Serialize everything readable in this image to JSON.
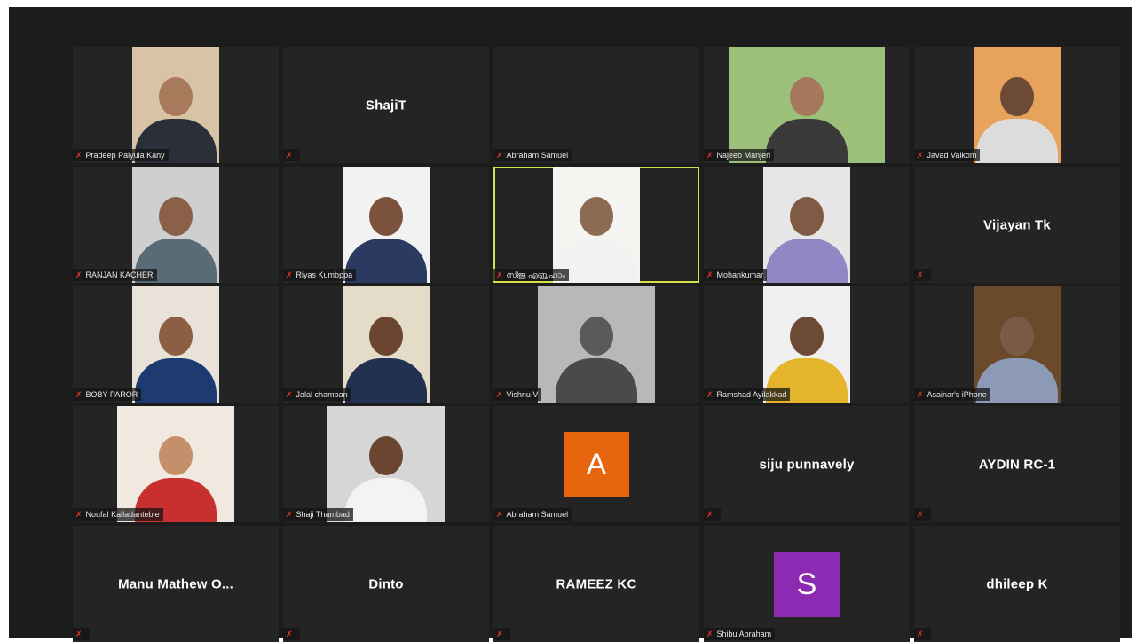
{
  "colors": {
    "background": "#1c1c1c",
    "tile": "#242424",
    "active_border": "#d6e04a",
    "muted_mic": "#e0342f"
  },
  "tiles": [
    {
      "id": "t0",
      "name": "Pradeep Paiyula Kany",
      "video": true,
      "bg": "#d9c3a6",
      "skin": "#a87a5c",
      "shirt": "#2b2f3a"
    },
    {
      "id": "t1",
      "name": "ShajiT",
      "video": false
    },
    {
      "id": "t2",
      "name": "Abraham Samuel",
      "video": false,
      "show_big": false
    },
    {
      "id": "t3",
      "name": "Najeeb Manjeri",
      "video": true,
      "bg": "#9cc07a",
      "skin": "#a5785d",
      "shirt": "#3a3a3a"
    },
    {
      "id": "t4",
      "name": "Javad Valkom",
      "video": true,
      "bg": "#e7a35c",
      "skin": "#6d4a35",
      "shirt": "#dcdcdc"
    },
    {
      "id": "t5",
      "name": "RANJAN KACHER",
      "video": true,
      "bg": "#cfcfcf",
      "skin": "#8a6048",
      "shirt": "#5a6b78"
    },
    {
      "id": "t6",
      "name": "Riyas Kumbppa",
      "video": true,
      "bg": "#f2f2f2",
      "skin": "#7b523c",
      "shirt": "#2a3a60"
    },
    {
      "id": "t7",
      "name": "സിജു എബ്രഹാം",
      "video": true,
      "bg": "#f4f4f0",
      "skin": "#8d6b52",
      "shirt": "#f2f2f2",
      "active": true
    },
    {
      "id": "t8",
      "name": "Mohankumar",
      "video": true,
      "bg": "#e6e6e6",
      "skin": "#7f5a44",
      "shirt": "#9088c4"
    },
    {
      "id": "t9",
      "name": "Vijayan Tk",
      "video": false
    },
    {
      "id": "t10",
      "name": "BOBY PAROR",
      "video": true,
      "bg": "#e8e2d8",
      "skin": "#8c5f45",
      "shirt": "#1d3b70"
    },
    {
      "id": "t11",
      "name": "Jalal chamban",
      "video": true,
      "bg": "#e4dcc8",
      "skin": "#6b4530",
      "shirt": "#223150"
    },
    {
      "id": "t12",
      "name": "Vishnu V",
      "video": true,
      "bg": "#b8b8b8",
      "skin": "#5a5a5a",
      "shirt": "#4a4a4a"
    },
    {
      "id": "t13",
      "name": "Ramshad Ayilakkad",
      "video": true,
      "bg": "#efefef",
      "skin": "#6c4a35",
      "shirt": "#e4b52a"
    },
    {
      "id": "t14",
      "name": "Asainar's iPhone",
      "video": true,
      "bg": "#6b4a2c",
      "skin": "#7b5a48",
      "shirt": "#8c9ab8"
    },
    {
      "id": "t15",
      "name": "Noufal Kalladanteble",
      "video": true,
      "bg": "#f1e9df",
      "skin": "#c48f6a",
      "shirt": "#c83030"
    },
    {
      "id": "t16",
      "name": "Shaji Thambad",
      "video": true,
      "bg": "#d6d6d6",
      "skin": "#6a4632",
      "shirt": "#f3f3f3"
    },
    {
      "id": "t17",
      "name": "Abraham Samuel",
      "video": false,
      "avatar": "A",
      "avatar_color": "#e8650f"
    },
    {
      "id": "t18",
      "name": "siju punnavely",
      "video": false
    },
    {
      "id": "t19",
      "name": "AYDIN RC-1",
      "video": false
    },
    {
      "id": "t20",
      "name": "Manu Mathew O...",
      "video": false
    },
    {
      "id": "t21",
      "name": "Dinto",
      "video": false
    },
    {
      "id": "t22",
      "name": "RAMEEZ KC",
      "video": false
    },
    {
      "id": "t23",
      "name": "Shibu Abraham",
      "video": false,
      "avatar": "S",
      "avatar_color": "#8b2bb4"
    },
    {
      "id": "t24",
      "name": "dhileep K",
      "video": false
    }
  ],
  "icons": {
    "muted_mic": "mic-muted-icon"
  }
}
